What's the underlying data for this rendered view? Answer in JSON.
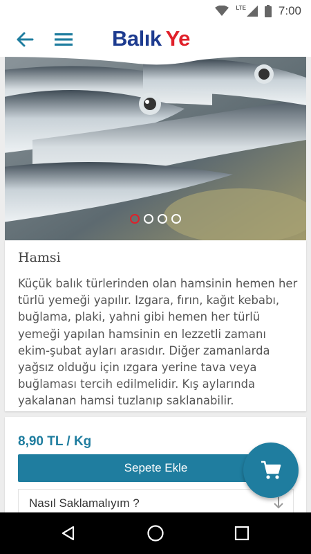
{
  "status_bar": {
    "time": "7:00",
    "network": "LTE"
  },
  "app_bar": {
    "logo_part1": "Balık",
    "logo_part2": "Ye"
  },
  "hero": {
    "slide_count": 4,
    "active_slide": 1
  },
  "product": {
    "title": "Hamsi",
    "description": "Küçük balık türlerinden olan hamsinin hemen her türlü yemeği yapılır. Izgara, fırın, kağıt kebabı, buğlama, plaki, yahni gibi hemen her türlü yemeği yapılan hamsinin en lezzetli zamanı ekim-şubat ayları arasıdır. Diğer zamanlarda yağsız olduğu için ızgara yerine tava veya buğlaması tercih edilmelidir. Kış aylarında yakalanan hamsi tuzlanıp saklanabilir.",
    "price": "8,90 TL / Kg",
    "add_to_cart_label": "Sepete Ekle",
    "faq_label": "Nasıl Saklamalıyım ?"
  },
  "colors": {
    "accent": "#1f7d9f",
    "brand_blue": "#1d3b8f",
    "brand_red": "#e0202a"
  }
}
